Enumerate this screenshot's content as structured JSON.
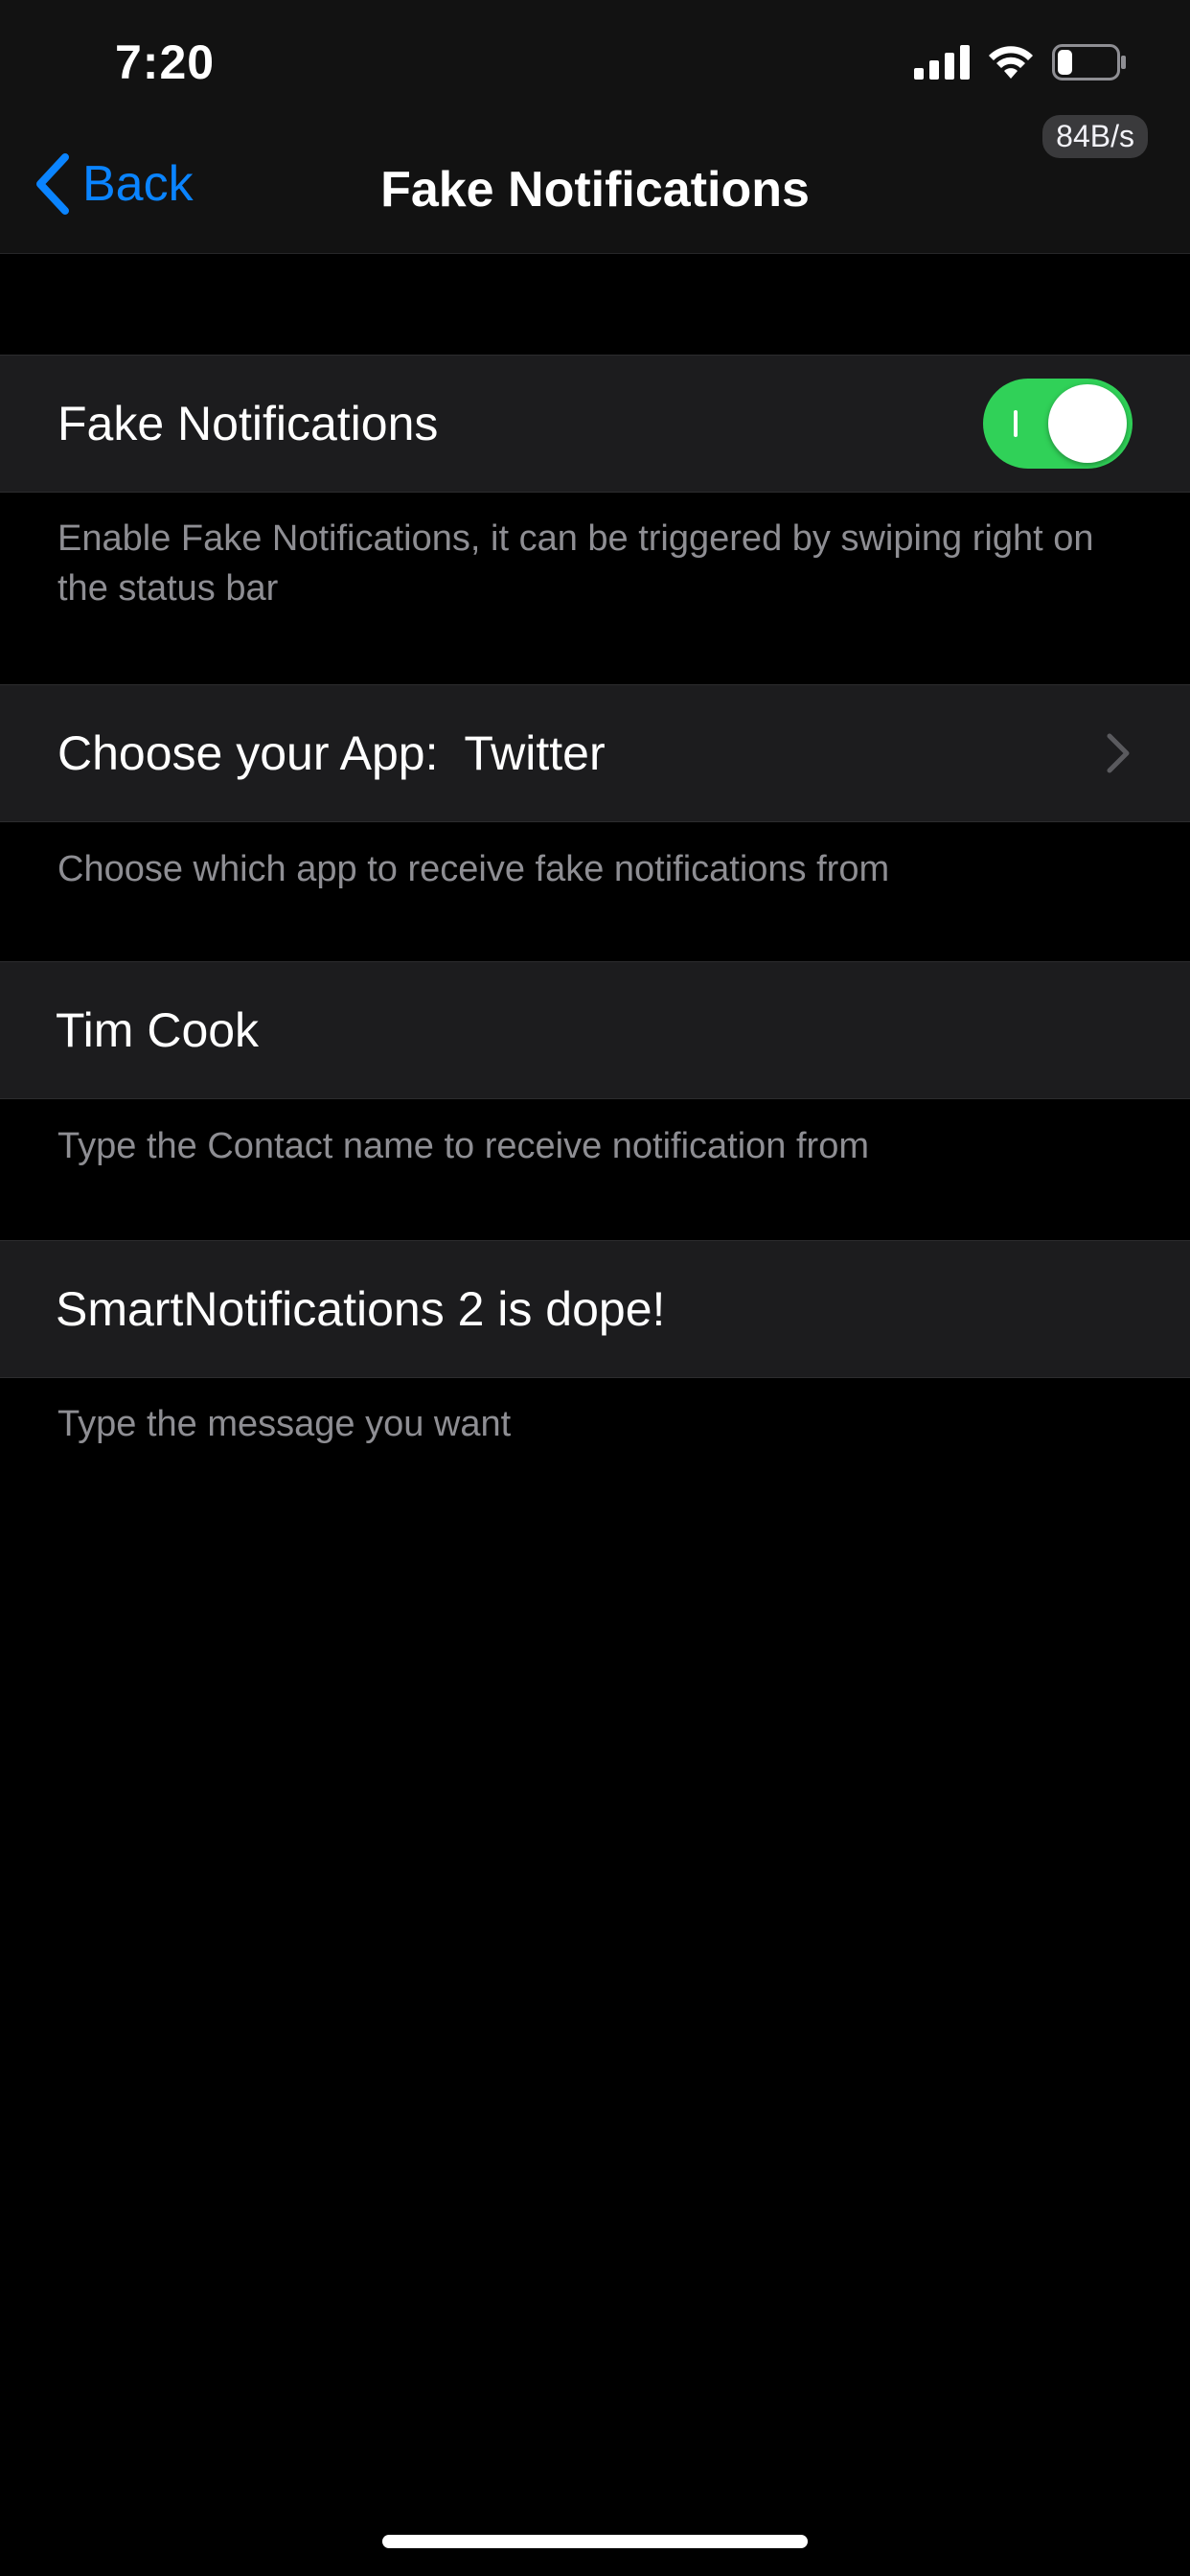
{
  "status_bar": {
    "time": "7:20",
    "network_speed": "84B/s",
    "battery_level_fraction": 0.25,
    "icons": [
      "cellular-signal-icon",
      "wifi-icon",
      "battery-icon"
    ]
  },
  "nav": {
    "back_label": "Back",
    "title": "Fake Notifications"
  },
  "settings": {
    "toggle_row": {
      "label": "Fake Notifications",
      "enabled": true,
      "footer": "Enable Fake Notifications, it can be triggered by swiping right on the status bar"
    },
    "app_row": {
      "label": "Choose your App:  Twitter",
      "footer": "Choose which app to receive fake notifications from"
    },
    "contact_row": {
      "value": "Tim Cook",
      "footer": "Type the Contact name to receive notification from"
    },
    "message_row": {
      "value": "SmartNotifications 2 is dope!",
      "footer": "Type the message you want"
    }
  },
  "colors": {
    "accent": "#0a84ff",
    "toggle_on": "#30d158",
    "cell_background": "#1c1c1e",
    "footer_text": "#8e8e93"
  }
}
